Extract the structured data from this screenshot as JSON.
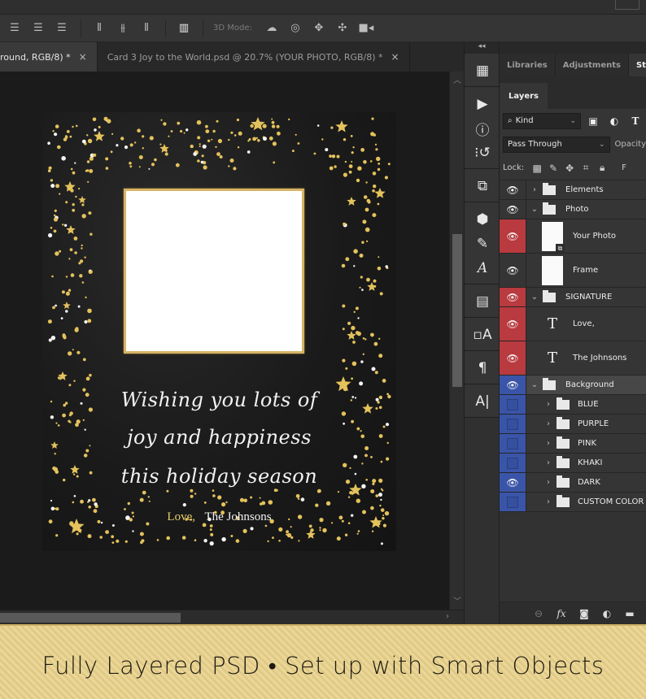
{
  "toolbar": {
    "align_icons": [
      "align-top-edges-icon",
      "align-vertical-centers-icon",
      "align-bottom-edges-icon",
      "align-left-edges-icon",
      "align-horizontal-centers-icon",
      "align-right-edges-icon"
    ],
    "distribute_icon": "distribute-columns-icon",
    "mode_label": "3D Mode:",
    "mode_icons": [
      "orbit-3d-icon",
      "roll-3d-icon",
      "drag-3d-icon",
      "slide-3d-icon",
      "scale-3d-camera-icon"
    ]
  },
  "tabs": [
    {
      "label": "round, RGB/8) *",
      "active": true
    },
    {
      "label": "Card 3 Joy to the World.psd @ 20.7% (YOUR PHOTO, RGB/8) *",
      "active": false
    }
  ],
  "tab_close_glyph": "×",
  "card": {
    "greeting_lines": [
      "Wishing you lots of",
      "joy and happiness",
      "this holiday season"
    ],
    "love": "Love,",
    "signature": "The Johnsons",
    "gold": "#e4c25c"
  },
  "dock": {
    "collapse_glyph": "◂◂",
    "groups": [
      [
        "swatches-grid-icon"
      ],
      [
        "play-actions-icon",
        "info-icon",
        "history-icon"
      ],
      [
        "transform-clone-icon"
      ],
      [
        "3d-icon",
        "brushes-icon",
        "glyphs-icon"
      ],
      [
        "properties-icon"
      ],
      [
        "character-styles-icon"
      ],
      [
        "paragraph-icon"
      ],
      [
        "character-icon"
      ]
    ]
  },
  "panel": {
    "tabs": [
      "Libraries",
      "Adjustments",
      "Styles"
    ],
    "active_tab": "Styles",
    "layers_tab": "Layers",
    "filter_kind": "Kind",
    "blend_mode": "Pass Through",
    "opacity_label": "Opacity",
    "lock_label": "Lock:",
    "fill_label": "F",
    "layers": [
      {
        "name": "Elements",
        "type": "group",
        "expanded": false,
        "visible": true,
        "color": "none",
        "indent": 0
      },
      {
        "name": "Photo",
        "type": "group",
        "expanded": true,
        "visible": true,
        "color": "none",
        "indent": 0
      },
      {
        "name": "Your Photo",
        "type": "smart",
        "visible": true,
        "color": "red",
        "indent": 1
      },
      {
        "name": "Frame",
        "type": "pixel",
        "visible": true,
        "color": "none",
        "indent": 1
      },
      {
        "name": "SIGNATURE",
        "type": "group",
        "expanded": true,
        "visible": true,
        "color": "red",
        "indent": 0
      },
      {
        "name": "Love,",
        "type": "text",
        "visible": true,
        "color": "red",
        "indent": 1
      },
      {
        "name": "The Johnsons",
        "type": "text",
        "visible": true,
        "color": "red",
        "indent": 1
      },
      {
        "name": "Background",
        "type": "group",
        "expanded": true,
        "visible": true,
        "color": "blue",
        "indent": 0,
        "selected": true
      },
      {
        "name": "BLUE",
        "type": "group",
        "expanded": false,
        "visible": false,
        "color": "blue",
        "indent": 1
      },
      {
        "name": "PURPLE",
        "type": "group",
        "expanded": false,
        "visible": false,
        "color": "blue",
        "indent": 1
      },
      {
        "name": "PINK",
        "type": "group",
        "expanded": false,
        "visible": false,
        "color": "blue",
        "indent": 1
      },
      {
        "name": "KHAKI",
        "type": "group",
        "expanded": false,
        "visible": false,
        "color": "blue",
        "indent": 1
      },
      {
        "name": "DARK",
        "type": "group",
        "expanded": false,
        "visible": true,
        "color": "blue",
        "indent": 1
      },
      {
        "name": "CUSTOM COLOR",
        "type": "group",
        "expanded": false,
        "visible": false,
        "color": "blue",
        "indent": 1
      }
    ],
    "footer_icons": [
      "link-layers-icon",
      "fx-icon",
      "add-mask-icon",
      "adjustment-layer-icon",
      "new-group-icon"
    ]
  },
  "banner": {
    "text": "Fully Layered PSD • Set up with Smart Objects"
  }
}
